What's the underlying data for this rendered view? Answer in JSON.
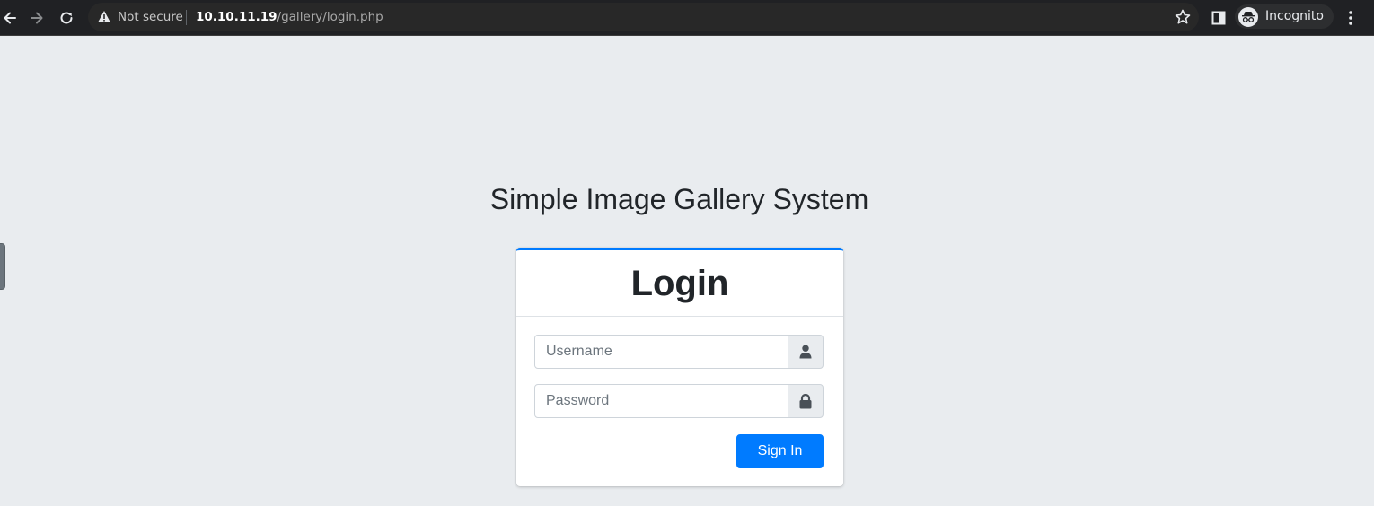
{
  "browser": {
    "omnibox": {
      "security_label": "Not secure",
      "url_host": "10.10.11.19",
      "url_path": "/gallery/login.php"
    },
    "profile_label": "Incognito",
    "icons": [
      "back-icon",
      "forward-icon",
      "reload-icon",
      "warning-icon",
      "star-icon",
      "side-panel-icon",
      "incognito-icon",
      "menu-icon"
    ]
  },
  "page": {
    "heading": "Simple Image Gallery System",
    "login_card": {
      "title": "Login",
      "username_placeholder": "Username",
      "password_placeholder": "Password",
      "submit_label": "Sign In",
      "username_icon": "user-icon",
      "password_icon": "lock-icon"
    }
  },
  "colors": {
    "accent": "#007bff",
    "page_background": "#e9ecef",
    "toolbar_background": "#202124"
  }
}
